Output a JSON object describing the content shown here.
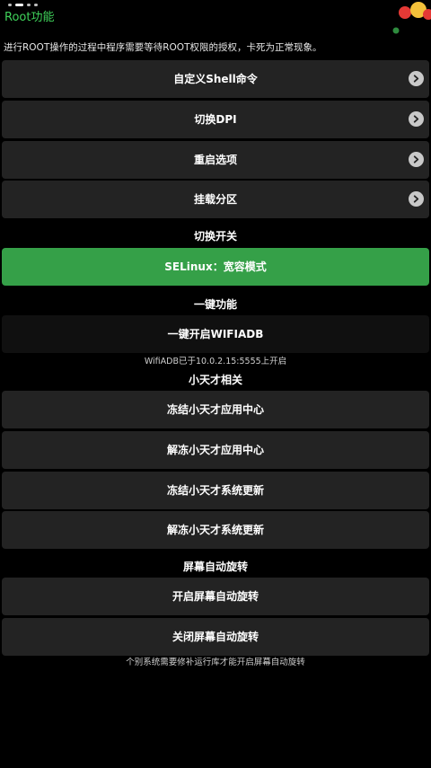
{
  "header": {
    "title": "Root功能",
    "notice": "进行ROOT操作的过程中程序需要等待ROOT权限的授权，卡死为正常现象。"
  },
  "menu": {
    "items": [
      {
        "label": "自定义Shell命令",
        "icon": "chevron-right-icon"
      },
      {
        "label": "切换DPI",
        "icon": "chevron-right-icon"
      },
      {
        "label": "重启选项",
        "icon": "chevron-right-icon"
      },
      {
        "label": "挂载分区",
        "icon": "chevron-right-icon"
      }
    ]
  },
  "switch_section": {
    "title": "切换开关",
    "selinux_label": "SELinux：宽容模式"
  },
  "one_key_section": {
    "title": "一键功能",
    "wifi_adb_label": "一键开启WIFIADB",
    "wifi_adb_status": "WifiADB已于10.0.2.15:5555上开启"
  },
  "genius_section": {
    "title": "小天才相关",
    "items": [
      {
        "label": "冻结小天才应用中心"
      },
      {
        "label": "解冻小天才应用中心"
      },
      {
        "label": "冻结小天才系统更新"
      },
      {
        "label": "解冻小天才系统更新"
      }
    ]
  },
  "rotation_section": {
    "title": "屏幕自动旋转",
    "enable_label": "开启屏幕自动旋转",
    "disable_label": "关闭屏幕自动旋转",
    "note": "个别系统需要修补运行库才能开启屏幕自动旋转"
  },
  "colors": {
    "accent_green": "#3fd25a",
    "selinux_button": "#35a048",
    "card_background": "#232323"
  }
}
